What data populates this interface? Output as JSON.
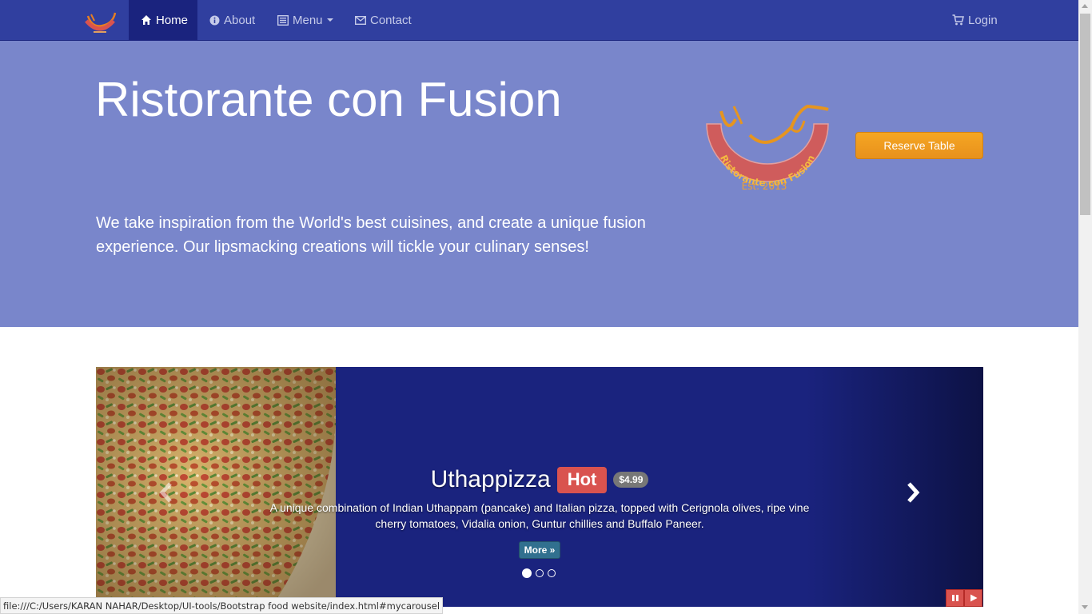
{
  "nav": {
    "home": "Home",
    "about": "About",
    "menu": "Menu",
    "contact": "Contact",
    "login": "Login"
  },
  "jumbotron": {
    "title": "Ristorante con Fusion",
    "text": "We take inspiration from the World's best cuisines, and create a unique fusion experience. Our lipsmacking creations will tickle your culinary senses!",
    "logo_text": "Ristorante con Fusion",
    "logo_est": "Est. 2013",
    "reserve_button": "Reserve Table"
  },
  "carousel": {
    "title": "Uthappizza",
    "label": "Hot",
    "price": "$4.99",
    "description": "A unique combination of Indian Uthappam (pancake) and Italian pizza, topped with Cerignola olives, ripe vine cherry tomatoes, Vidalia onion, Guntur chillies and Buffalo Paneer.",
    "more_button": "More »",
    "slide_count": 3,
    "active_slide": 1
  },
  "status_bar": {
    "url": "file:///C:/Users/KARAN NAHAR/Desktop/UI-tools/Bootstrap food website/index.html#mycarousel"
  },
  "colors": {
    "navbar": "#303f9f",
    "navbar_active": "#1a237e",
    "jumbotron": "#7986cb",
    "reserve_button": "#f0a020",
    "badge_hot": "#d9534f",
    "carousel_bg": "#1a237e"
  },
  "icons": {
    "home": "home-icon",
    "about": "info-circle-icon",
    "menu": "list-alt-icon",
    "contact": "envelope-icon",
    "login": "shopping-cart-icon"
  }
}
